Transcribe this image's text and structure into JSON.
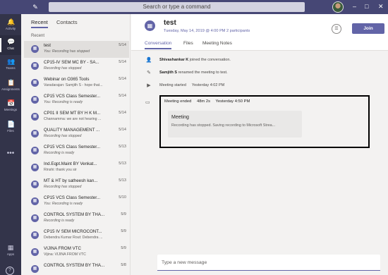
{
  "topbar": {
    "search_placeholder": "Search or type a command",
    "compose_icon": "new-chat-icon",
    "window": {
      "minimize": "–",
      "maximize": "□",
      "close": "✕"
    }
  },
  "rail": {
    "items": [
      {
        "label": "Activity",
        "icon": "bell-icon",
        "glyph": "🔔"
      },
      {
        "label": "Chat",
        "icon": "chat-icon",
        "glyph": "💬"
      },
      {
        "label": "Teams",
        "icon": "teams-icon",
        "glyph": "👥"
      },
      {
        "label": "Assignments",
        "icon": "assignments-icon",
        "glyph": "📋"
      },
      {
        "label": "Meetings",
        "icon": "calendar-icon",
        "glyph": "📅"
      },
      {
        "label": "Files",
        "icon": "files-icon",
        "glyph": "📄"
      }
    ],
    "more": "•••",
    "apps_label": "Apps",
    "help": "?"
  },
  "chat_list": {
    "tabs": [
      "Recent",
      "Contacts"
    ],
    "section": "Recent",
    "items": [
      {
        "title": "test",
        "sub": "You: Recording has stopped",
        "date": "5/14",
        "italic": true
      },
      {
        "title": "CP15-IV SEM MC BY - SA...",
        "sub": "Recording has stopped",
        "date": "5/14",
        "italic": true
      },
      {
        "title": "Webinar on O365 Tools",
        "sub": "Varadarajan: Samjith S - hope that...",
        "date": "5/14",
        "italic": false
      },
      {
        "title": "CP15 VCS Class Semester...",
        "sub": "You: Recording is ready",
        "date": "5/14",
        "italic": true
      },
      {
        "title": "CP01 II SEM MT BY H K M...",
        "sub": "Channamma: we are not hearing ...",
        "date": "5/14",
        "italic": false
      },
      {
        "title": "QUALITY MANAGEMENT ...",
        "sub": "Recording has stopped",
        "date": "5/14",
        "italic": true
      },
      {
        "title": "CP15 VCS Class Semester...",
        "sub": "Recording is ready",
        "date": "5/13",
        "italic": true
      },
      {
        "title": "Ind.Eqpt.Maint BY Venkat...",
        "sub": "Rinshi: thank you sir",
        "date": "5/13",
        "italic": false
      },
      {
        "title": "MT & HT by satheesh kan...",
        "sub": "Recording has stopped",
        "date": "5/13",
        "italic": true
      },
      {
        "title": "CP15 VCS Class Semester...",
        "sub": "You: Recording is ready",
        "date": "5/10",
        "italic": true
      },
      {
        "title": "CONTROL SYSTEM BY THA...",
        "sub": "Recording is ready",
        "date": "5/9",
        "italic": true
      },
      {
        "title": "CP15 IV SEM MICROCONT...",
        "sub": "Debendra Kumar Rout: Debendra ...",
        "date": "5/9",
        "italic": false
      },
      {
        "title": "VIJINA FROM VTC",
        "sub": "Vijina: VIJINA FROM VTC",
        "date": "5/9",
        "italic": false
      },
      {
        "title": "CONTROL SYSTEM BY THA...",
        "sub": "",
        "date": "5/8",
        "italic": false
      }
    ]
  },
  "meeting": {
    "title": "test",
    "subtitle": "Tuesday, May 14, 2019 @ 4:00 PM 2 participants",
    "join_label": "Join",
    "tabs": [
      "Conversation",
      "Files",
      "Meeting Notes"
    ],
    "events": [
      {
        "icon": "person-add-icon",
        "glyph": "👤",
        "actor": "Shivashankar K",
        "text": " joined the conversation.",
        "time": ""
      },
      {
        "icon": "edit-icon",
        "glyph": "✎",
        "actor": "Samjith S",
        "text": " renamed the meeting to test.",
        "time": ""
      },
      {
        "icon": "video-icon",
        "glyph": "▶",
        "actor": "",
        "text": "Meeting started",
        "time": "Yesterday 4:02 PM"
      }
    ],
    "ended": {
      "label": "Meeting ended",
      "duration": "48m 2s",
      "time": "Yesterday 4:50 PM",
      "card_title": "Meeting",
      "card_sub": "Recording has stopped. Saving recording to Microsoft Strea..."
    }
  },
  "composer": {
    "placeholder": "Type a new message"
  }
}
